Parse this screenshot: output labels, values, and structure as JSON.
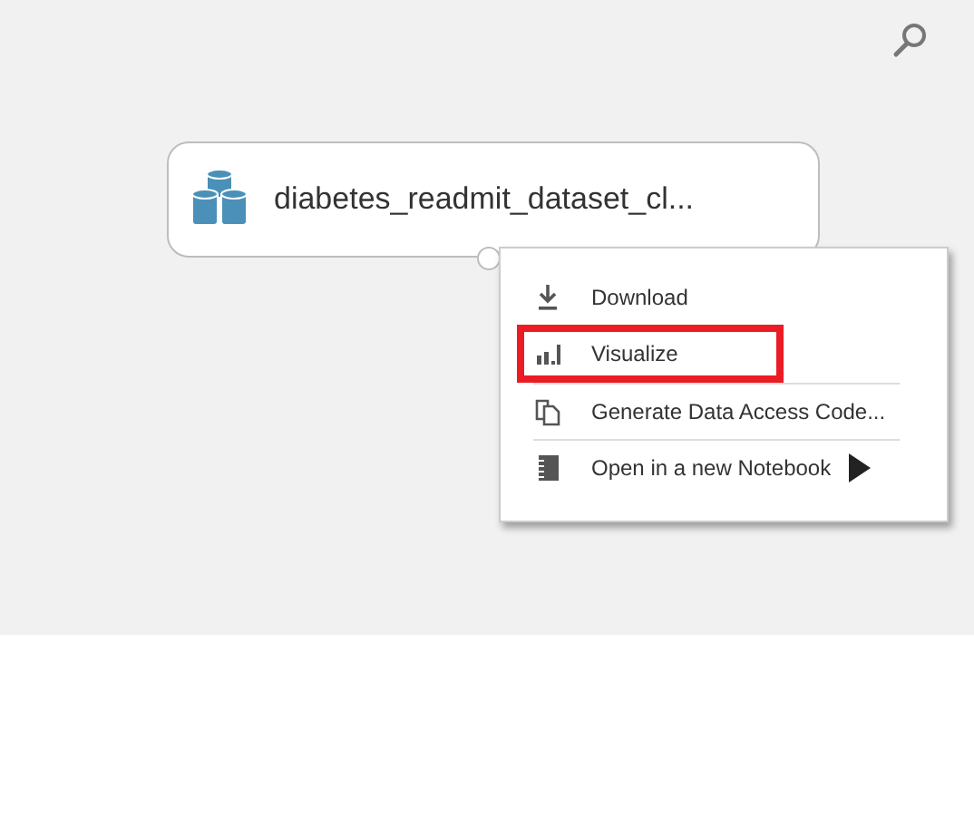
{
  "canvas": {
    "module": {
      "title": "diabetes_readmit_dataset_cl..."
    },
    "context_menu": {
      "items": [
        {
          "kind": "download",
          "label": "Download",
          "highlighted": false,
          "submenu": false,
          "divider_before": false
        },
        {
          "kind": "visualize",
          "label": "Visualize",
          "highlighted": true,
          "submenu": false,
          "divider_before": false
        },
        {
          "kind": "code",
          "label": "Generate Data Access Code...",
          "highlighted": false,
          "submenu": false,
          "divider_before": true
        },
        {
          "kind": "notebook",
          "label": "Open in a new Notebook",
          "highlighted": false,
          "submenu": true,
          "divider_before": true
        }
      ]
    }
  }
}
